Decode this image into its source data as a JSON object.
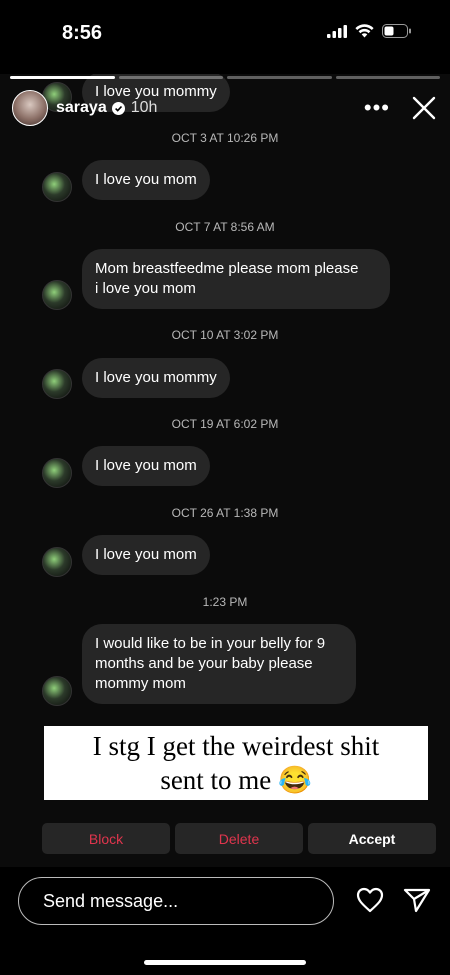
{
  "status": {
    "time": "8:56"
  },
  "story": {
    "username": "saraya",
    "time_ago": "10h",
    "progress_segments": 4,
    "active_segment": 0
  },
  "messages": {
    "partial_top": "I love you mommy",
    "items": [
      {
        "timestamp": "OCT 3 AT 10:26 PM",
        "text": "I love you mom"
      },
      {
        "timestamp": "OCT 7 AT 8:56 AM",
        "text": "Mom breastfeedme please mom please\ni love you mom"
      },
      {
        "timestamp": "OCT 10 AT 3:02 PM",
        "text": "I love you mommy"
      },
      {
        "timestamp": "OCT 19 AT 6:02 PM",
        "text": "I love you mom"
      },
      {
        "timestamp": "OCT 26 AT 1:38 PM",
        "text": "I love you mom"
      },
      {
        "timestamp": "1:23 PM",
        "text": "I would like to be in your belly for 9\nmonths and be your baby please\nmommy mom"
      }
    ]
  },
  "caption": {
    "line1": "I stg I get the weirdest shit",
    "line2": "sent to me 😂"
  },
  "request_actions": {
    "block": "Block",
    "delete": "Delete",
    "accept": "Accept"
  },
  "composer": {
    "placeholder": "Send message..."
  },
  "colors": {
    "danger": "#e0354d",
    "bubble": "#262626",
    "background": "#000000"
  }
}
